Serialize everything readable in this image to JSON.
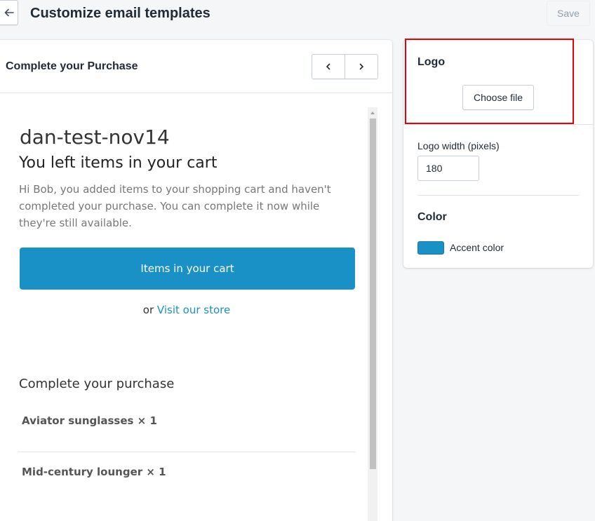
{
  "header": {
    "title": "Customize email templates",
    "save_label": "Save",
    "back_icon": "arrow-left-icon"
  },
  "preview": {
    "title": "Complete your Purchase",
    "prev_icon": "chevron-left-icon",
    "next_icon": "chevron-right-icon",
    "email": {
      "shop_name": "dan-test-nov14",
      "heading": "You left items in your cart",
      "body": "Hi Bob, you added items to your shopping cart and haven't completed your purchase. You can complete it now while they're still available.",
      "cta_label": "Items in your cart",
      "or_text": "or",
      "store_link": "Visit our store",
      "section_heading": "Complete your purchase",
      "items": [
        {
          "label": "Aviator sunglasses × 1"
        },
        {
          "label": "Mid-century lounger × 1"
        }
      ]
    }
  },
  "settings": {
    "logo": {
      "label": "Logo",
      "button_label": "Choose file"
    },
    "logo_width": {
      "label": "Logo width (pixels)",
      "value": "180"
    },
    "color": {
      "label": "Color",
      "accent_label": "Accent color",
      "accent_hex": "#1990c6"
    }
  }
}
